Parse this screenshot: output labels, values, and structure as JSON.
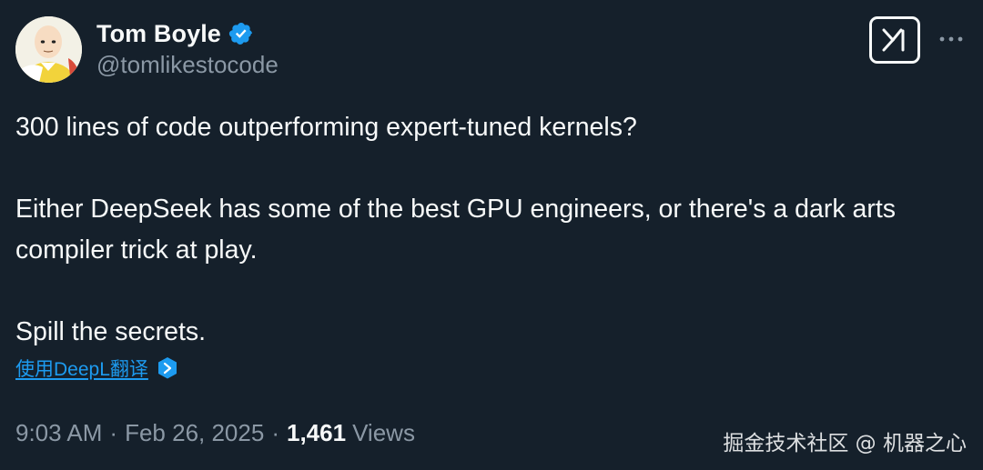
{
  "author": {
    "display_name": "Tom Boyle",
    "handle": "@tomlikestocode",
    "verified_color": "#1d9bf0"
  },
  "tweet": {
    "paragraphs": [
      "300 lines of code outperforming expert-tuned kernels?",
      "Either DeepSeek has some of the best GPU engineers, or there's a dark arts compiler trick at play.",
      "Spill the secrets."
    ],
    "translate_label": "使用DeepL翻译"
  },
  "meta": {
    "time": "9:03 AM",
    "separator": "·",
    "date": "Feb 26, 2025",
    "views_count": "1,461",
    "views_label": "Views"
  },
  "watermark": "掘金技术社区 @ 机器之心",
  "icons": {
    "verified": "verified-badge-icon",
    "x_logo": "x-logo-icon",
    "more": "more-options-icon",
    "deepl": "deepl-icon"
  },
  "colors": {
    "background": "#15202b",
    "primary_text": "#f7f9f9",
    "secondary_text": "#8b98a5",
    "link": "#1d9bf0"
  }
}
